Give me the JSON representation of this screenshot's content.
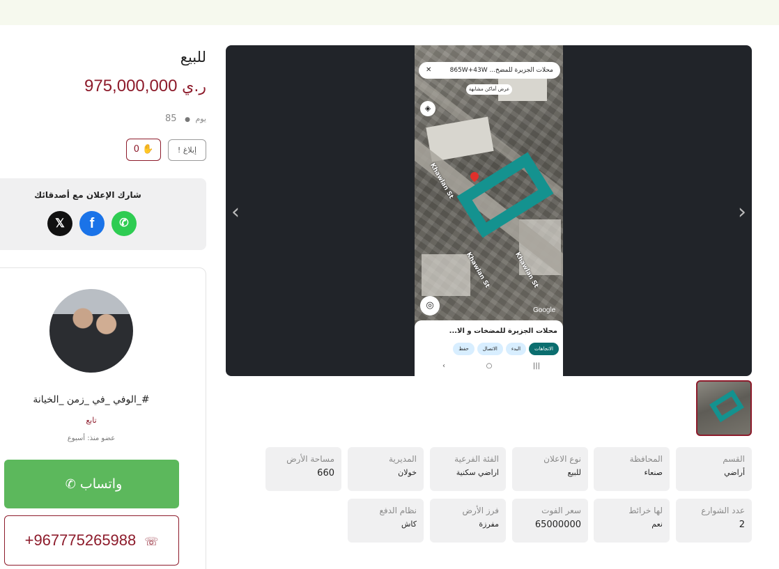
{
  "listing": {
    "type_label": "للبيع",
    "price": "975,000,000",
    "currency": "ر.ي",
    "days_label": "يوم",
    "views": "85",
    "report_label": "إبلاغ",
    "likes": "0"
  },
  "share": {
    "title": "شارك الإعلان مع أصدقائك",
    "x_label": "𝕏",
    "facebook_label": "f",
    "whatsapp_label": "✆"
  },
  "seller": {
    "name": "#_الوفي _في _زمن _الخيانة",
    "follow_label": "تابع",
    "member_since": "عضو منذ: أسبوع",
    "whatsapp_label": "واتساب",
    "phone": "+967775265988"
  },
  "gallery": {
    "prev_icon": "‹",
    "next_icon": "›",
    "screenshot": {
      "search_text": "محلات الجزيرة للمضخ... 865W+43W",
      "close": "✕",
      "similar_places": "عرض أماكن مشابهة",
      "street_1": "Khawlan St",
      "street_2": "Khawlan St",
      "street_3": "Khawlan St",
      "google": "Google",
      "place_title": "محلات الجزيرة للمضخات و الا...",
      "actions": [
        "الاتجاهات",
        "البدء",
        "الاتصال",
        "حفظ"
      ],
      "nav": [
        "‹",
        "○",
        "|||"
      ]
    }
  },
  "specs": [
    {
      "label": "القسم",
      "value": "أراضي"
    },
    {
      "label": "المحافظة",
      "value": "صنعاء"
    },
    {
      "label": "نوع الاعلان",
      "value": "للبيع"
    },
    {
      "label": "الفئة الفرعية",
      "value": "اراضي سكنية"
    },
    {
      "label": "المديرية",
      "value": "خولان"
    },
    {
      "label": "مساحة الأرض",
      "value": "660"
    },
    {
      "label": "عدد الشوارع",
      "value": "2"
    },
    {
      "label": "لها خرائط",
      "value": "نعم"
    },
    {
      "label": "سعر الفوت",
      "value": "65000000"
    },
    {
      "label": "فرز الأرض",
      "value": "مفرزة"
    },
    {
      "label": "نظام الدفع",
      "value": "كاش"
    }
  ]
}
